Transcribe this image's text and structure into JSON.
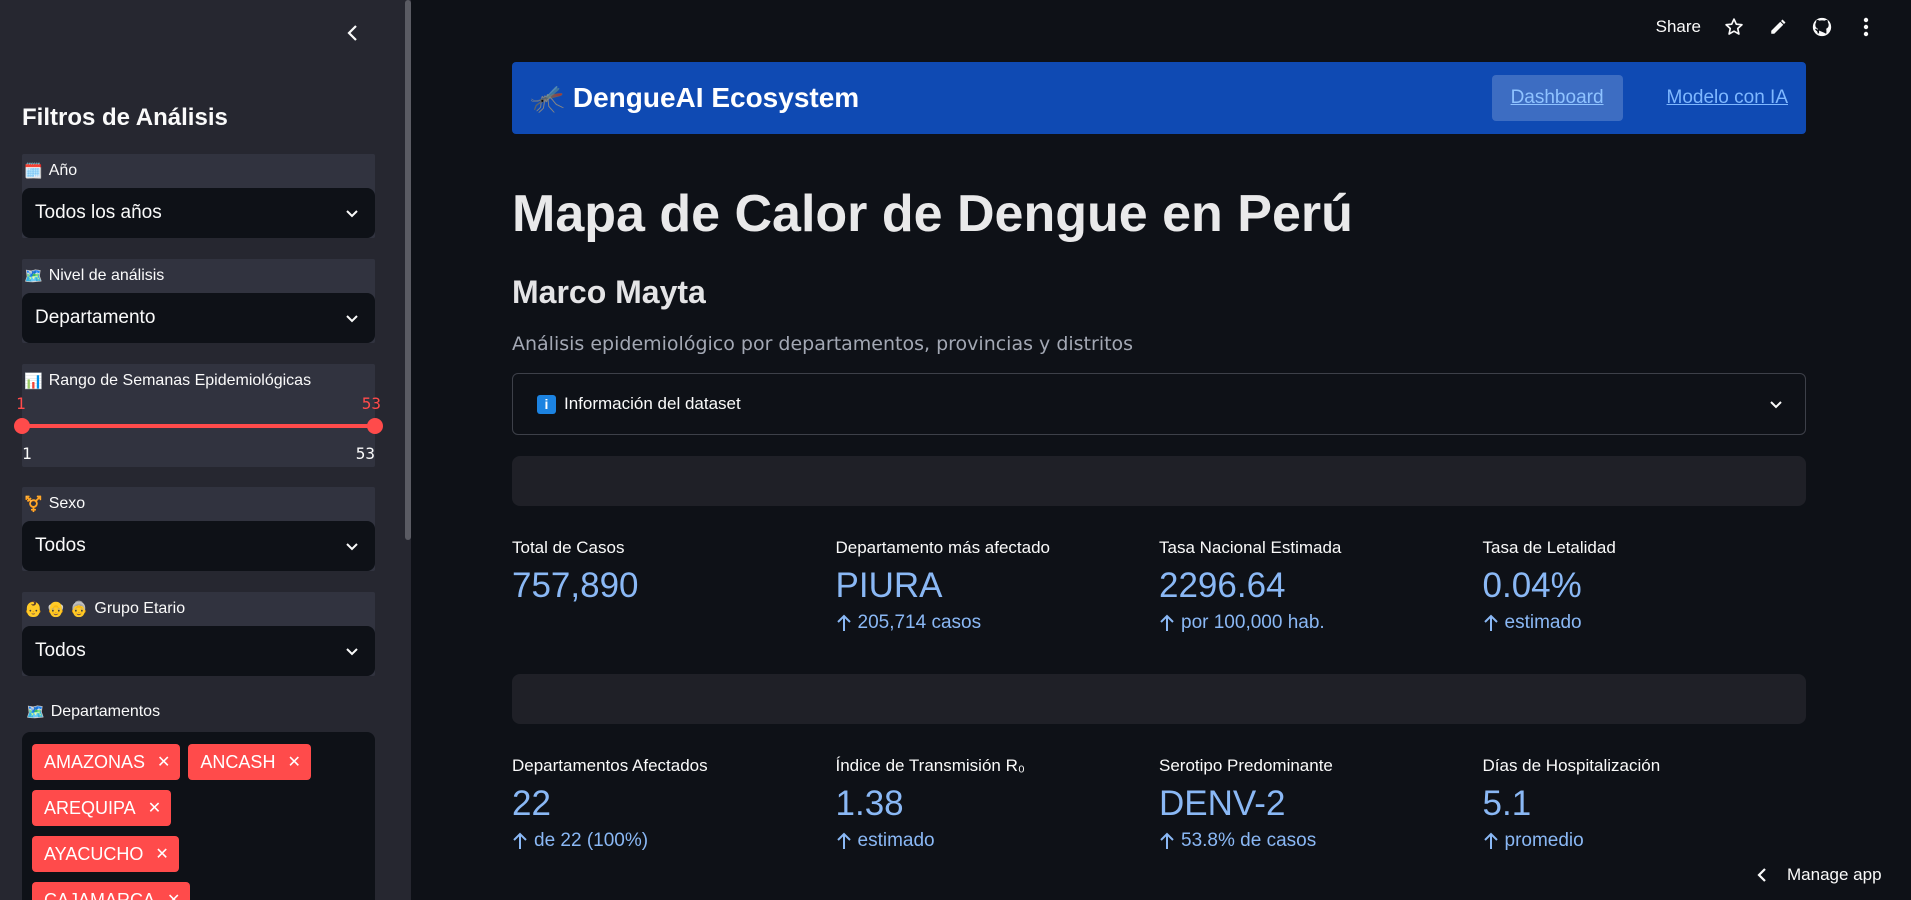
{
  "sidebar": {
    "title": "Filtros de Análisis",
    "year": {
      "emoji": "🗓️",
      "label": "Año",
      "value": "Todos los años"
    },
    "level": {
      "emoji": "🗺️",
      "label": "Nivel de análisis",
      "value": "Departamento"
    },
    "weeks": {
      "emoji": "📊",
      "label": "Rango de Semanas Epidemiológicas",
      "low": 1,
      "high": 53,
      "min": 1,
      "max": 53,
      "low_text": "1",
      "high_text": "53",
      "min_text": "1",
      "max_text": "53"
    },
    "sex": {
      "emoji": "⚧️",
      "label": "Sexo",
      "value": "Todos"
    },
    "age": {
      "emoji": "👶 👴 👵",
      "label": "Grupo Etario",
      "value": "Todos"
    },
    "departments": {
      "emoji": "🗺️",
      "label": "Departamentos",
      "tags": [
        "AMAZONAS",
        "ANCASH",
        "AREQUIPA",
        "AYACUCHO",
        "CAJAMARCA"
      ]
    }
  },
  "topbar": {
    "share_label": "Share"
  },
  "navbar": {
    "brand_icon": "🦟",
    "brand": "DengueAI Ecosystem",
    "links": [
      "Dashboard",
      "Modelo con IA"
    ]
  },
  "main": {
    "title": "Mapa de Calor de Dengue en Perú",
    "author": "Marco Mayta",
    "subtitle": "Análisis epidemiológico por departamentos, provincias y distritos",
    "expander": {
      "icon": "i",
      "label": "Información del dataset"
    }
  },
  "metrics_row1": [
    {
      "label": "Total de Casos",
      "value": "757,890",
      "delta": ""
    },
    {
      "label": "Departamento más afectado",
      "value": "PIURA",
      "delta": "205,714 casos"
    },
    {
      "label": "Tasa Nacional Estimada",
      "value": "2296.64",
      "delta": "por 100,000 hab."
    },
    {
      "label": "Tasa de Letalidad",
      "value": "0.04%",
      "delta": "estimado"
    }
  ],
  "metrics_row2": [
    {
      "label": "Departamentos Afectados",
      "value": "22",
      "delta": "de 22 (100%)"
    },
    {
      "label": "Índice de Transmisión R₀",
      "value": "1.38",
      "delta": "estimado"
    },
    {
      "label": "Serotipo Predominante",
      "value": "DENV-2",
      "delta": "53.8% de casos"
    },
    {
      "label": "Días de Hospitalización",
      "value": "5.1",
      "delta": "promedio"
    }
  ],
  "manage_app": "Manage app",
  "colors": {
    "accent": "#ff4b4b",
    "navbar": "#0f4ab3",
    "metric": "#8ab8f5"
  }
}
